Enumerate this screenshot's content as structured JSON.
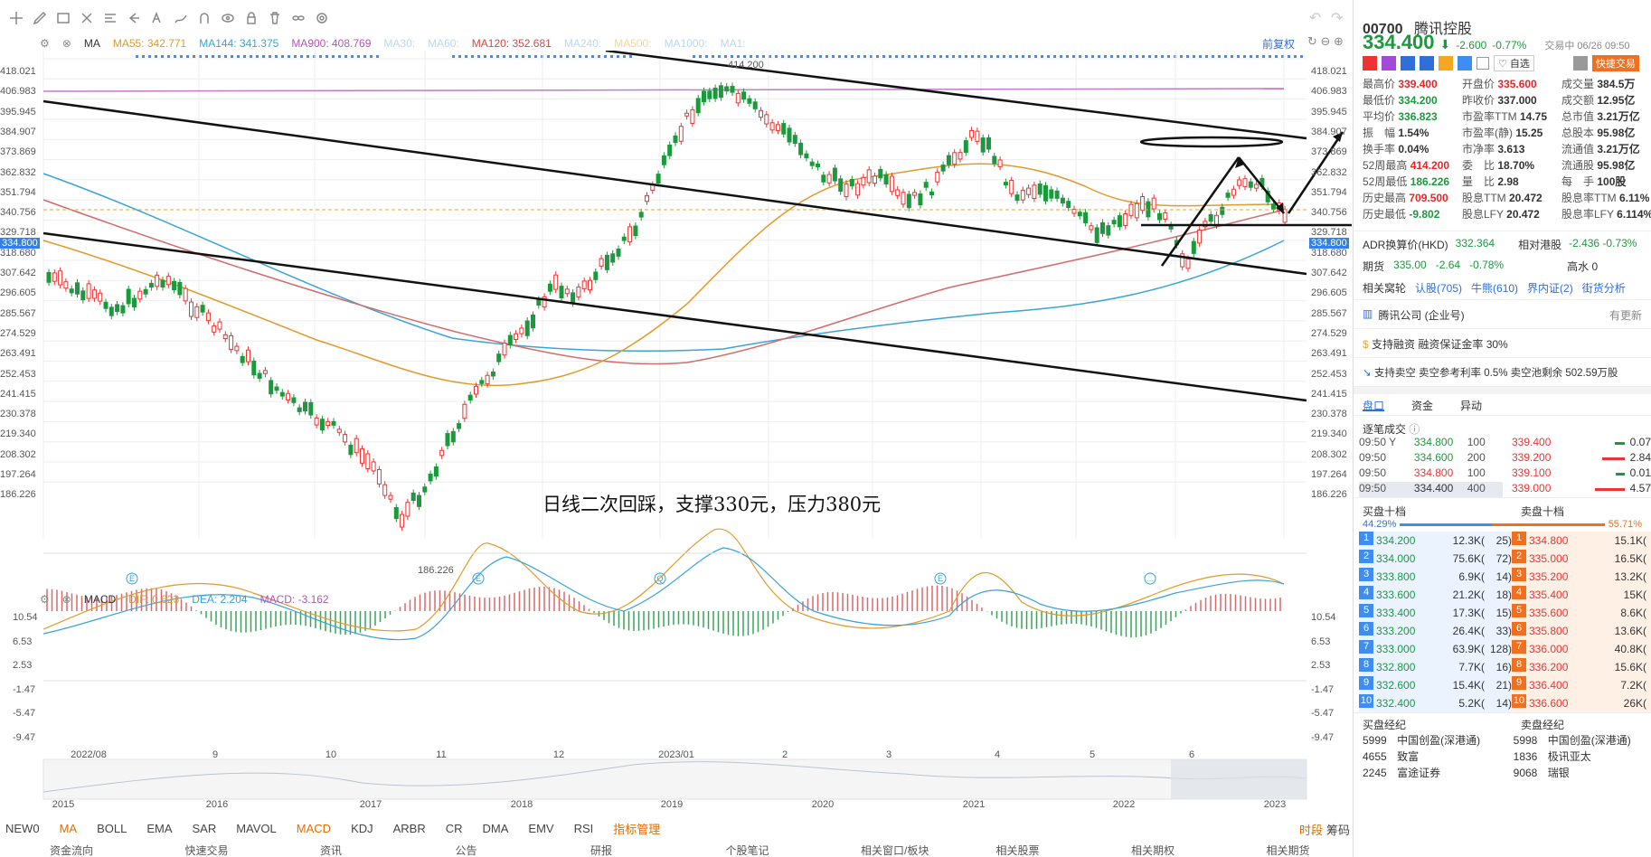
{
  "toolbar": {
    "icons": [
      "crosshair-icon",
      "pen-icon",
      "rect-icon",
      "scissors-icon",
      "ruler-icon",
      "arrow-icon",
      "text-icon",
      "draw-icon",
      "magnet-icon",
      "eye-icon",
      "lock-icon",
      "trash-icon",
      "link-icon",
      "settings-icon"
    ]
  },
  "ma_legend": {
    "type": "MA",
    "ma55": "MA55: 342.771",
    "ma144": "MA144: 341.375",
    "ma900": "MA900: 408.769",
    "ma30": "MA30:",
    "ma60": "MA60:",
    "ma120": "MA120: 352.681",
    "ma240": "MA240:",
    "ma500": "MA500:",
    "ma1000": "MA1000:",
    "ma1": "MA1:",
    "adjust": "前复权"
  },
  "price_axis": [
    "418.021",
    "406.983",
    "395.945",
    "384.907",
    "373.869",
    "362.832",
    "351.794",
    "340.756",
    "329.718",
    "318.680",
    "307.642",
    "296.605",
    "285.567",
    "274.529",
    "263.491",
    "252.453",
    "241.415",
    "230.378",
    "219.340",
    "208.302",
    "197.264",
    "186.226"
  ],
  "current_price_tag": "334.800",
  "annotations": {
    "high": "414.200",
    "low": "186.226",
    "note": "日线二次回踩，支撑330元，压力380元"
  },
  "macd_legend": {
    "type": "MACD",
    "dif": "DIF: 0.623",
    "dea": "DEA: 2.204",
    "macd": "MACD: -3.162"
  },
  "macd_axis": [
    "10.54",
    "6.53",
    "2.53",
    "-1.47",
    "-5.47",
    "-9.47"
  ],
  "x_axis": [
    "2022/08",
    "9",
    "10",
    "11",
    "12",
    "2023/01",
    "2",
    "3",
    "4",
    "5",
    "6"
  ],
  "overview_axis": [
    "2015",
    "2016",
    "2017",
    "2018",
    "2019",
    "2020",
    "2021",
    "2022",
    "2023"
  ],
  "indicator_tabs": [
    "NEW0",
    "MA",
    "BOLL",
    "EMA",
    "SAR",
    "MAVOL",
    "MACD",
    "KDJ",
    "ARBR",
    "CR",
    "DMA",
    "EMV",
    "RSI",
    "指标管理"
  ],
  "bottom_right": [
    "时段",
    "筹码"
  ],
  "bottom_cols": [
    "资金流向",
    "快速交易",
    "资讯",
    "公告",
    "研报",
    "个股笔记",
    "相关窗口/板块",
    "相关股票",
    "相关期权",
    "相关期货"
  ],
  "stock": {
    "code": "00700",
    "name": "腾讯控股",
    "price": "334.400",
    "change": "-2.600",
    "pct": "-0.77%",
    "status": "交易中 06/26 09:50",
    "watch": "自选",
    "quick": "快捷交易"
  },
  "quote": [
    [
      "最高价",
      "339.400",
      "开盘价",
      "335.600",
      "成交量",
      "384.5万"
    ],
    [
      "最低价",
      "334.200",
      "昨收价",
      "337.000",
      "成交额",
      "12.95亿"
    ],
    [
      "平均价",
      "336.823",
      "市盈率TTM",
      "14.75",
      "总市值",
      "3.21万亿"
    ],
    [
      "振　幅",
      "1.54%",
      "市盈率(静)",
      "15.25",
      "总股本",
      "95.98亿"
    ],
    [
      "换手率",
      "0.04%",
      "市净率",
      "3.613",
      "流通值",
      "3.21万亿"
    ],
    [
      "52周最高",
      "414.200",
      "委　比",
      "18.70%",
      "流通股",
      "95.98亿"
    ],
    [
      "52周最低",
      "186.226",
      "量　比",
      "2.98",
      "每　手",
      "100股"
    ],
    [
      "历史最高",
      "709.500",
      "股息TTM",
      "20.472",
      "股息率TTM",
      "6.11%"
    ],
    [
      "历史最低",
      "-9.802",
      "股息LFY",
      "20.472",
      "股息率LFY",
      "6.114%"
    ]
  ],
  "adr": {
    "label": "ADR换算价(HKD)",
    "value": "332.364",
    "rel_label": "相对港股",
    "rel": "-2.436 -0.73%"
  },
  "futures": {
    "label": "期货",
    "value": "335.00",
    "chg": "-2.64",
    "pct": "-0.78%",
    "right": "高水 0"
  },
  "warrants": {
    "label": "相关窝轮",
    "items": [
      "认股(705)",
      "牛熊(610)",
      "界内证(2)",
      "街货分析"
    ]
  },
  "company": {
    "name": "腾讯公司 (企业号)",
    "right": "有更新"
  },
  "margin": "支持融资 融资保证金率 30%",
  "short": "支持卖空 卖空参考利率 0.5% 卖空池剩余 502.59万股",
  "detail_tabs": [
    "盘口",
    "资金",
    "异动"
  ],
  "ticks_title": "逐笔成交",
  "ticks": [
    [
      "09:50 Y",
      "334.800",
      "100"
    ],
    [
      "09:50",
      "334.600",
      "200"
    ],
    [
      "09:50",
      "334.800",
      "100"
    ],
    [
      "09:50",
      "334.400",
      "400"
    ]
  ],
  "price_vol": [
    [
      "339.400",
      "0.07"
    ],
    [
      "339.200",
      "2.84"
    ],
    [
      "339.100",
      "0.01"
    ],
    [
      "339.000",
      "4.57"
    ]
  ],
  "book": {
    "buy_title": "买盘十档",
    "sell_title": "卖盘十档",
    "buy_pct": "44.29%",
    "sell_pct": "55.71%",
    "bids": [
      [
        "1",
        "334.200",
        "12.3K(",
        "25)"
      ],
      [
        "2",
        "334.000",
        "75.6K(",
        "72)"
      ],
      [
        "3",
        "333.800",
        "6.9K(",
        "14)"
      ],
      [
        "4",
        "333.600",
        "21.2K(",
        "18)"
      ],
      [
        "5",
        "333.400",
        "17.3K(",
        "15)"
      ],
      [
        "6",
        "333.200",
        "26.4K(",
        "33)"
      ],
      [
        "7",
        "333.000",
        "63.9K(",
        "128)"
      ],
      [
        "8",
        "332.800",
        "7.7K(",
        "16)"
      ],
      [
        "9",
        "332.600",
        "15.4K(",
        "21)"
      ],
      [
        "10",
        "332.400",
        "5.2K(",
        "14)"
      ]
    ],
    "asks": [
      [
        "1",
        "334.800",
        "15.1K("
      ],
      [
        "2",
        "335.000",
        "16.5K("
      ],
      [
        "3",
        "335.200",
        "13.2K("
      ],
      [
        "4",
        "335.400",
        "15K("
      ],
      [
        "5",
        "335.600",
        "8.6K("
      ],
      [
        "6",
        "335.800",
        "13.6K("
      ],
      [
        "7",
        "336.000",
        "40.8K("
      ],
      [
        "8",
        "336.200",
        "15.6K("
      ],
      [
        "9",
        "336.400",
        "7.2K("
      ],
      [
        "10",
        "336.600",
        "26K("
      ]
    ]
  },
  "brokers": {
    "buy_title": "买盘经纪",
    "sell_title": "卖盘经纪",
    "buy": [
      [
        "5999",
        "中国创盈(深港通)"
      ],
      [
        "4655",
        "致富"
      ],
      [
        "2245",
        "富途证券"
      ]
    ],
    "sell": [
      [
        "5998",
        "中国创盈(深港通)"
      ],
      [
        "1836",
        "极讯亚太"
      ],
      [
        "9068",
        "瑞银"
      ]
    ]
  }
}
